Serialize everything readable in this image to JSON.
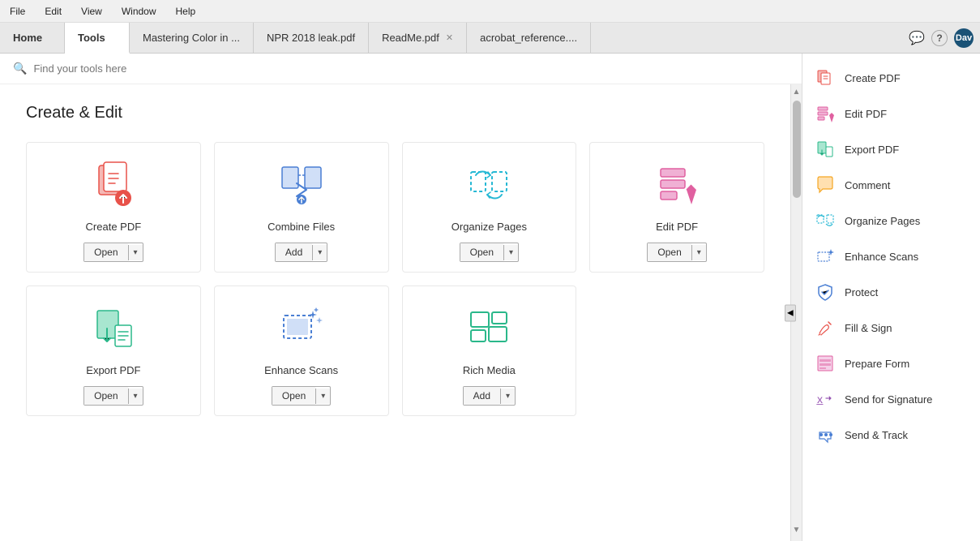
{
  "menu": {
    "items": [
      "File",
      "Edit",
      "View",
      "Window",
      "Help"
    ]
  },
  "tabs": [
    {
      "label": "Home",
      "active": false,
      "closable": false
    },
    {
      "label": "Tools",
      "active": true,
      "closable": false
    },
    {
      "label": "Mastering Color in ...",
      "active": false,
      "closable": false
    },
    {
      "label": "NPR 2018 leak.pdf",
      "active": false,
      "closable": false
    },
    {
      "label": "ReadMe.pdf",
      "active": false,
      "closable": true
    },
    {
      "label": "acrobat_reference....",
      "active": false,
      "closable": false
    }
  ],
  "tab_extras": {
    "chat_icon": "💬",
    "help_icon": "?",
    "user_label": "Dav"
  },
  "search": {
    "placeholder": "Find your tools here"
  },
  "section": {
    "title": "Create & Edit"
  },
  "tools": [
    {
      "name": "Create PDF",
      "btn_label": "Open",
      "btn_type": "open",
      "color": "#e8524a",
      "icon_type": "create-pdf"
    },
    {
      "name": "Combine Files",
      "btn_label": "Add",
      "btn_type": "add",
      "color": "#4a7fd4",
      "icon_type": "combine-files"
    },
    {
      "name": "Organize Pages",
      "btn_label": "Open",
      "btn_type": "open",
      "color": "#26b8d4",
      "icon_type": "organize-pages"
    },
    {
      "name": "Edit PDF",
      "btn_label": "Open",
      "btn_type": "open",
      "color": "#e060a0",
      "icon_type": "edit-pdf"
    },
    {
      "name": "Export PDF",
      "btn_label": "Open",
      "btn_type": "open",
      "color": "#2ab88a",
      "icon_type": "export-pdf"
    },
    {
      "name": "Enhance Scans",
      "btn_label": "Open",
      "btn_type": "open",
      "color": "#4a7fd4",
      "icon_type": "enhance-scans"
    },
    {
      "name": "Rich Media",
      "btn_label": "Add",
      "btn_type": "add",
      "color": "#2ab88a",
      "icon_type": "rich-media"
    }
  ],
  "sidebar": {
    "items": [
      {
        "label": "Create PDF",
        "icon": "create-pdf",
        "color": "#e8524a"
      },
      {
        "label": "Edit PDF",
        "icon": "edit-pdf",
        "color": "#e060a0"
      },
      {
        "label": "Export PDF",
        "icon": "export-pdf",
        "color": "#2ab88a"
      },
      {
        "label": "Comment",
        "icon": "comment",
        "color": "#f5a623"
      },
      {
        "label": "Organize Pages",
        "icon": "organize-pages",
        "color": "#26b8d4"
      },
      {
        "label": "Enhance Scans",
        "icon": "enhance-scans",
        "color": "#4a7fd4"
      },
      {
        "label": "Protect",
        "icon": "protect",
        "color": "#4a7fd4"
      },
      {
        "label": "Fill & Sign",
        "icon": "fill-sign",
        "color": "#e8524a"
      },
      {
        "label": "Prepare Form",
        "icon": "prepare-form",
        "color": "#e060a0"
      },
      {
        "label": "Send for Signature",
        "icon": "send-signature",
        "color": "#9b59b6"
      },
      {
        "label": "Send & Track",
        "icon": "send-track",
        "color": "#4a7fd4"
      }
    ]
  }
}
